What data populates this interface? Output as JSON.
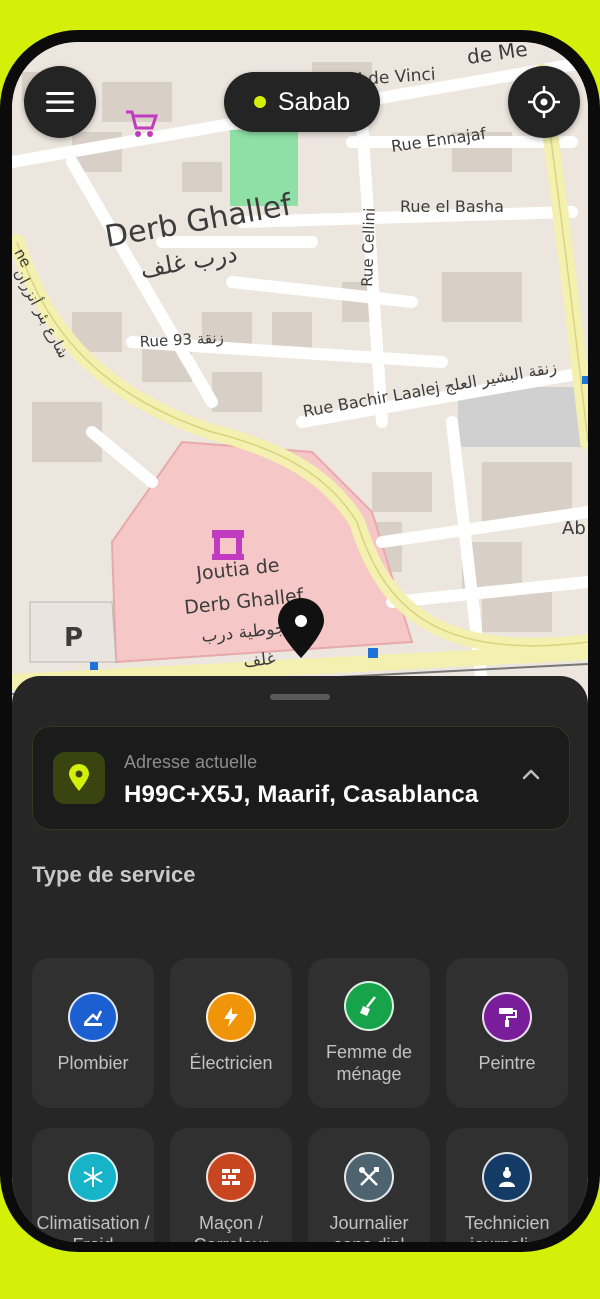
{
  "header": {
    "location_pill": "Sabab"
  },
  "map": {
    "labels": {
      "district": "Derb Ghallef",
      "district_ar": "درب غلف",
      "rue_leonard": "Rue Léonard de Vinci",
      "rue_ennajaf": "Rue Ennajaf",
      "rue_basha": "Rue el Basha",
      "rue_cellini": "Rue Cellini",
      "rue_93": "Rue 93 زنقة",
      "rue_bachir": "Rue Bachir Laalej زنقة البشير العلج",
      "rue_ar_left": "شارع بئر أنزران",
      "de_med": "de Me",
      "abd": "Ab",
      "joutia_1": "Joutia de",
      "joutia_2": "Derb Ghallef",
      "joutia_ar1": "جوطية درب",
      "joutia_ar2": "غلف",
      "parking": "P",
      "left_edge": "ne"
    }
  },
  "address": {
    "caption": "Adresse actuelle",
    "value": "H99C+X5J, Maarif, Casablanca"
  },
  "services": {
    "title": "Type de service",
    "items": [
      {
        "label": "Plombier",
        "icon": "plumber-icon",
        "color": "#1b5fd1"
      },
      {
        "label": "Électricien",
        "icon": "electricity-icon",
        "color": "#f0940a"
      },
      {
        "label": "Femme de ménage",
        "icon": "broom-icon",
        "color": "#16a34a"
      },
      {
        "label": "Peintre",
        "icon": "paint-roller-icon",
        "color": "#7a1d9a"
      },
      {
        "label": "Climatisation / Froid",
        "icon": "snowflake-icon",
        "color": "#17b3c9"
      },
      {
        "label": "Maçon / Carreleur",
        "icon": "brick-wall-icon",
        "color": "#c8461f"
      },
      {
        "label": "Journalier sans dipl",
        "icon": "tools-icon",
        "color": "#4d6470"
      },
      {
        "label": "Technicien journalier",
        "icon": "technician-icon",
        "color": "#143a66"
      }
    ]
  },
  "colors": {
    "accent": "#d4ef08",
    "sheet": "#262626",
    "tile": "#303030"
  }
}
